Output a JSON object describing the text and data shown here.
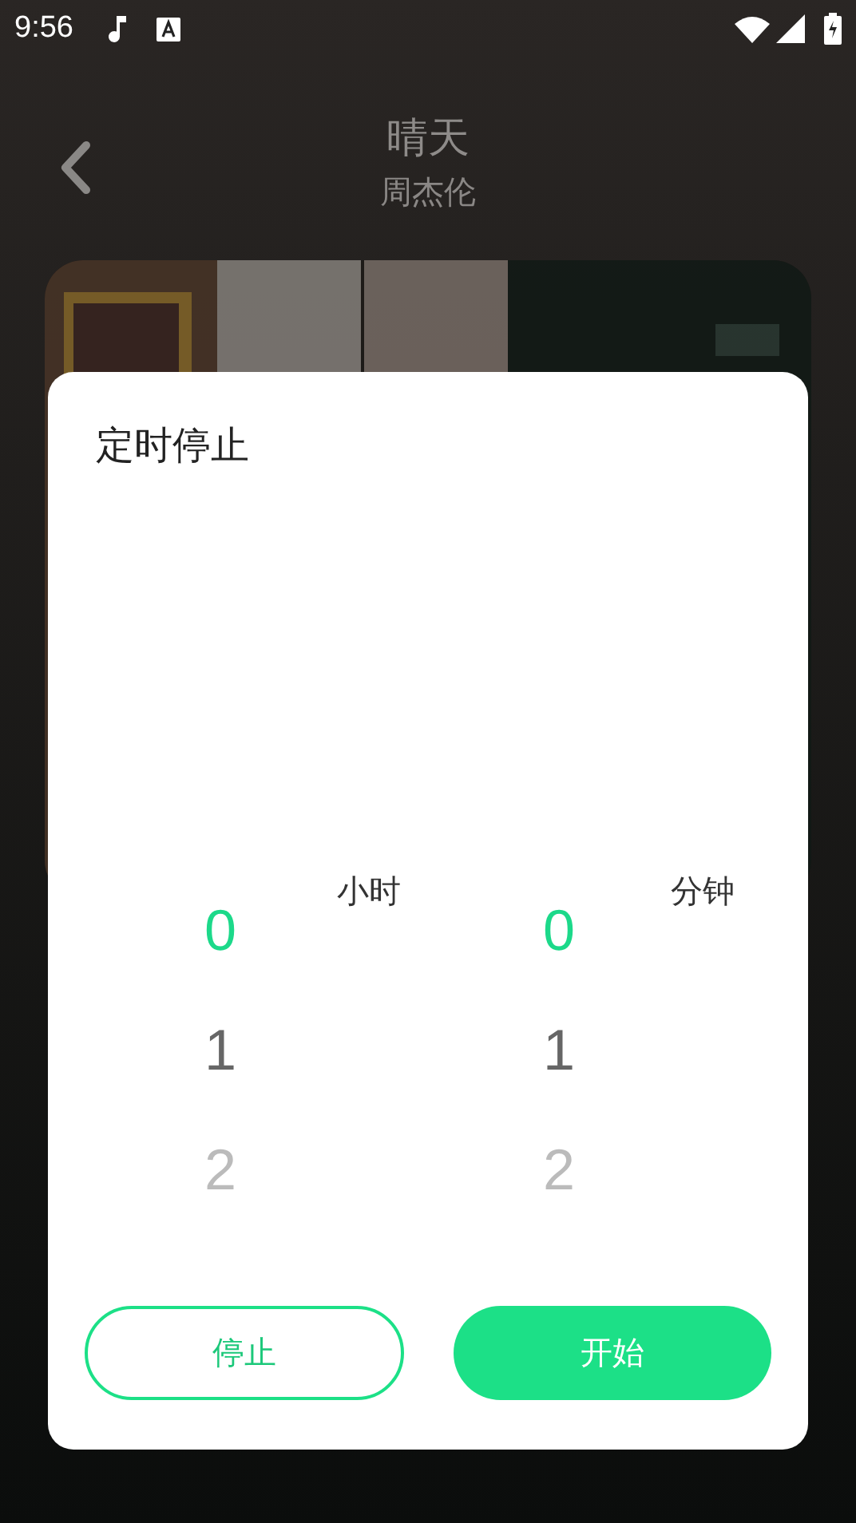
{
  "status_bar": {
    "time": "9:56"
  },
  "header": {
    "title": "晴天",
    "artist": "周杰伦"
  },
  "dialog": {
    "title": "定时停止",
    "pickers": [
      {
        "unit": "小时",
        "options": [
          {
            "label": "0",
            "selected": true
          },
          {
            "label": "1",
            "selected": false
          },
          {
            "label": "2",
            "selected": false
          }
        ]
      },
      {
        "unit": "分钟",
        "options": [
          {
            "label": "0",
            "selected": true
          },
          {
            "label": "1",
            "selected": false
          },
          {
            "label": "2",
            "selected": false
          }
        ]
      }
    ],
    "buttons": [
      {
        "label": "停止",
        "kind": "outline"
      },
      {
        "label": "开始",
        "kind": "filled"
      }
    ]
  }
}
